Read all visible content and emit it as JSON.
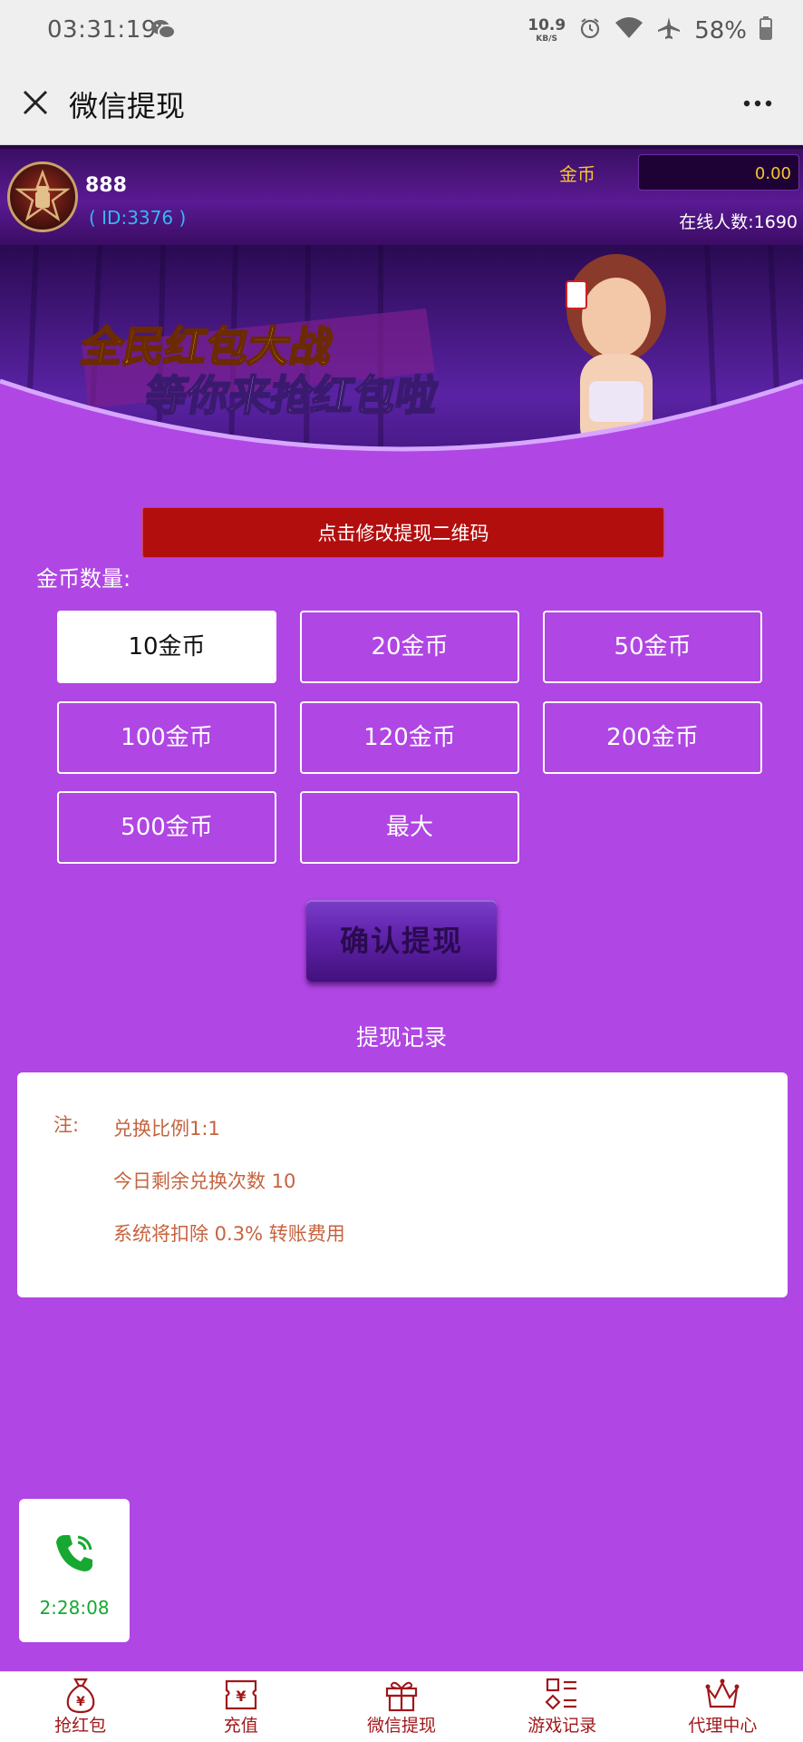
{
  "status_bar": {
    "time": "03:31:19",
    "net_speed": "10.9",
    "net_unit": "KB/S",
    "battery": "58%"
  },
  "title_bar": {
    "title": "微信提现"
  },
  "user": {
    "name": "888",
    "id": "( ID:3376 )",
    "coin_label": "金币",
    "coin_value": "0.00",
    "online": "在线人数:1690"
  },
  "banner": {
    "line1": "全民红包大战",
    "line2": "等你来抢红包啦"
  },
  "qr_button": "点击修改提现二维码",
  "amount_label": "金币数量:",
  "amount_options": [
    {
      "label": "10金币",
      "selected": true
    },
    {
      "label": "20金币",
      "selected": false
    },
    {
      "label": "50金币",
      "selected": false
    },
    {
      "label": "100金币",
      "selected": false
    },
    {
      "label": "120金币",
      "selected": false
    },
    {
      "label": "200金币",
      "selected": false
    },
    {
      "label": "500金币",
      "selected": false
    },
    {
      "label": "最大",
      "selected": false
    }
  ],
  "confirm_button": "确认提现",
  "records_link": "提现记录",
  "notes": {
    "label": "注:",
    "lines": [
      "兑换比例1:1",
      "今日剩余兑换次数 10",
      "系统将扣除 0.3% 转账费用"
    ]
  },
  "call": {
    "duration": "2:28:08",
    "icon": "phone-icon"
  },
  "bottom_nav": [
    {
      "label": "抢红包",
      "icon": "money-bag-icon"
    },
    {
      "label": "充值",
      "icon": "yen-ticket-icon"
    },
    {
      "label": "微信提现",
      "icon": "gift-icon"
    },
    {
      "label": "游戏记录",
      "icon": "grid-shapes-icon"
    },
    {
      "label": "代理中心",
      "icon": "crown-icon"
    }
  ],
  "colors": {
    "background": "#b046e3",
    "accent_red": "#b30e0e",
    "note_text": "#c6633e",
    "nav_text": "#a0171b",
    "call_green": "#17a832"
  }
}
